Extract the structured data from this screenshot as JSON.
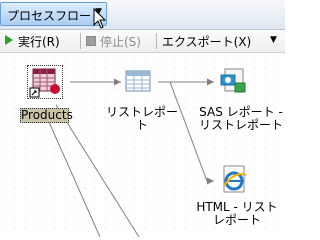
{
  "titlebar": {
    "flow_menu_label": "プロセスフロー"
  },
  "toolbar": {
    "run_label": "実行(R)",
    "stop_label": "停止(S)",
    "export_label": "エクスポート(X)"
  },
  "flow": {
    "nodes": {
      "products": "Products",
      "list_report": "リストレポート",
      "sas_report": "SAS レポート - リストレポート",
      "html_report": "HTML - リストレポート"
    }
  },
  "icons": [
    "data-table-icon",
    "shortcut-arrow-icon",
    "list-table-icon",
    "sas-report-icon",
    "html-ie-icon",
    "run-icon",
    "stop-icon",
    "mouse-cursor-icon"
  ],
  "colors": {
    "accent": "#a9cdf1",
    "run": "#2aa12a",
    "link": "#808080"
  }
}
